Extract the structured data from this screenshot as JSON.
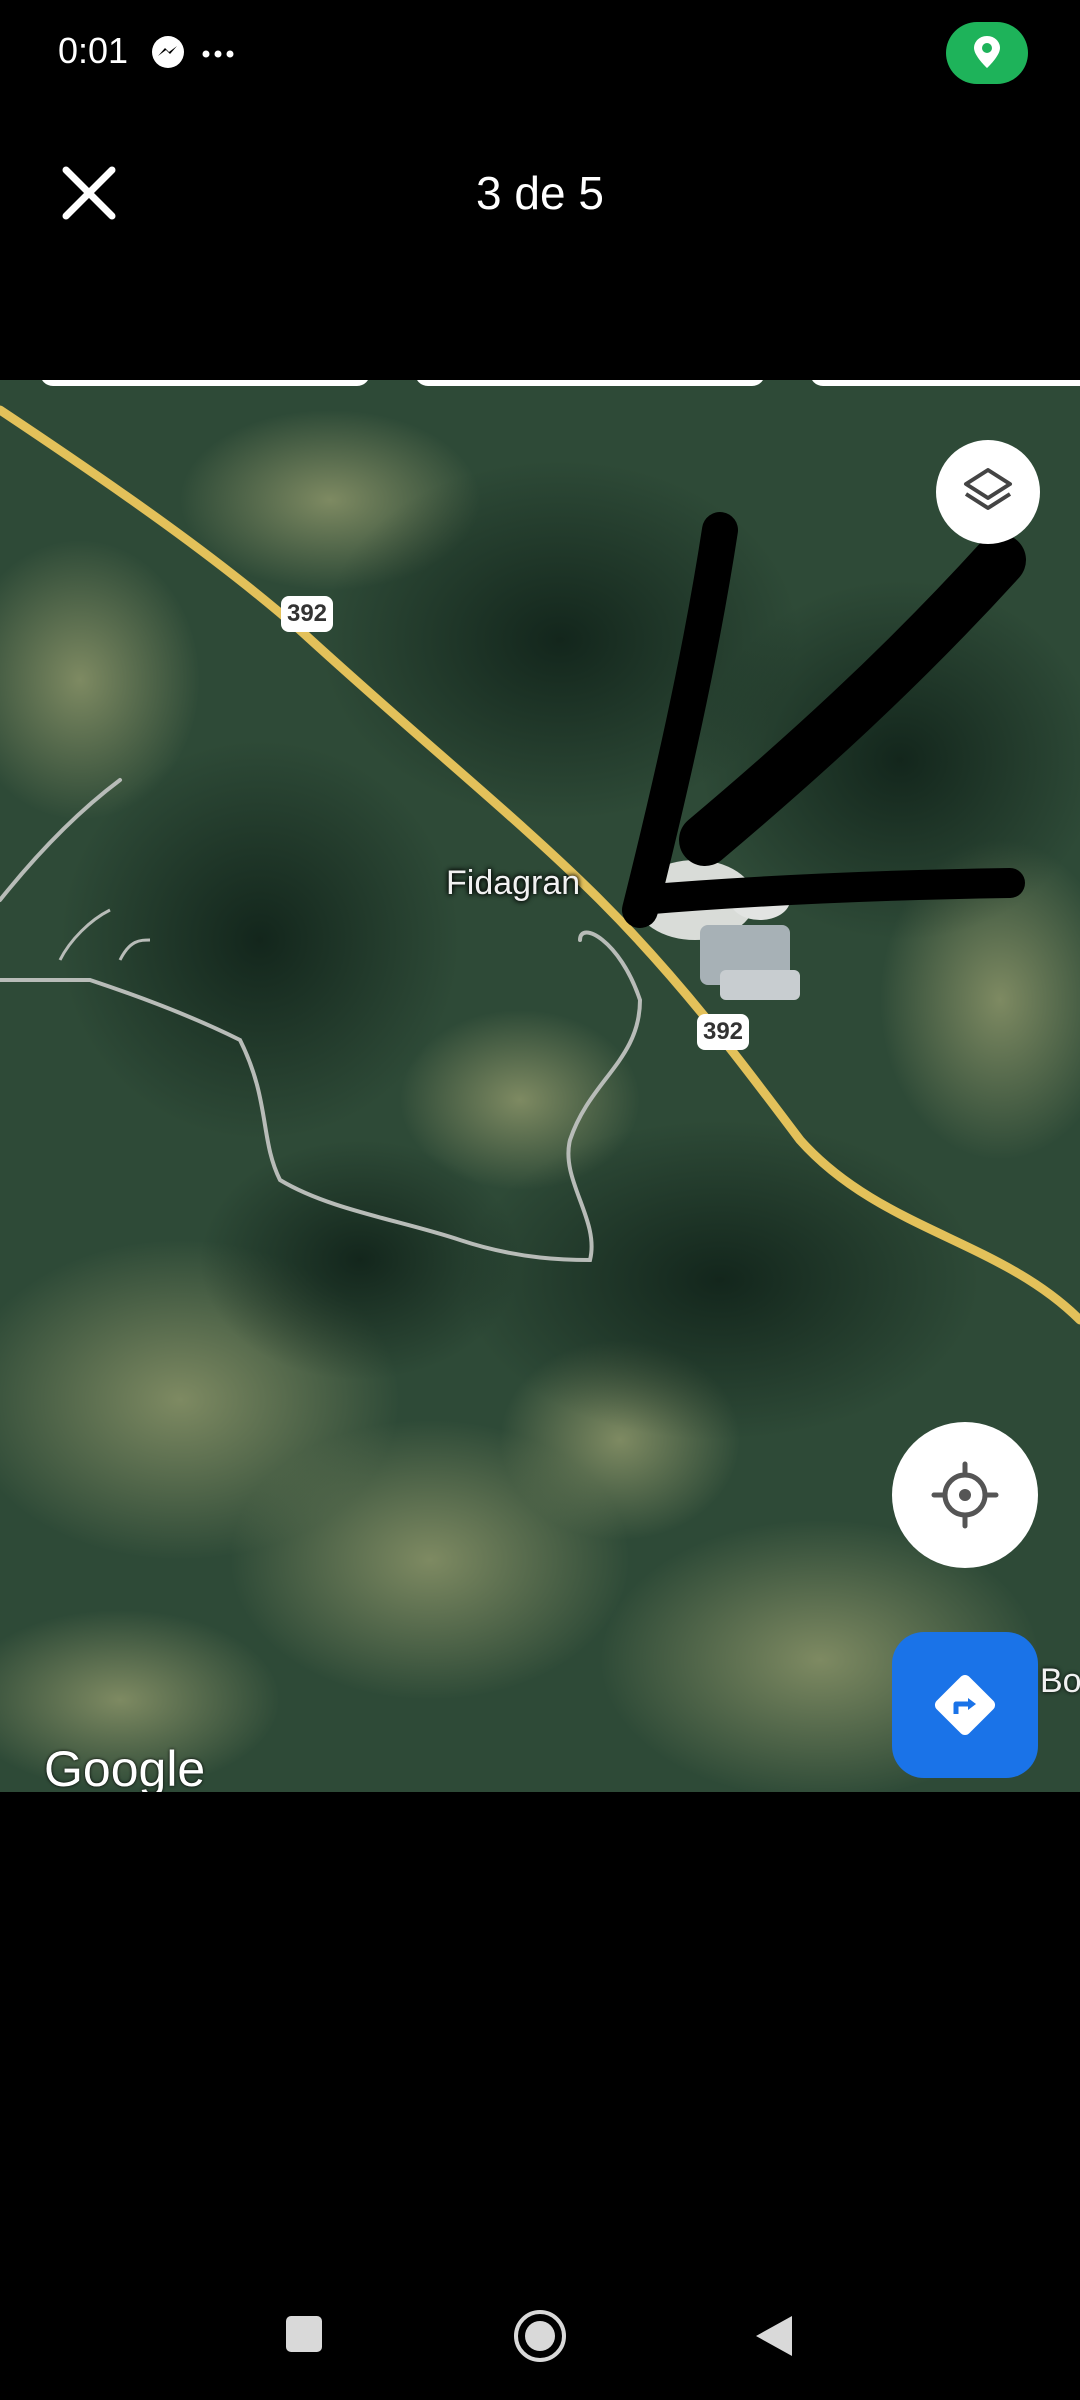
{
  "status_bar": {
    "time": "0:01",
    "icons": [
      "messenger-icon",
      "more-icon",
      "location-icon"
    ],
    "location_pill_color": "#1eb35a"
  },
  "viewer": {
    "counter": "3 de 5",
    "close_icon": "close-icon"
  },
  "map": {
    "place_label": "Fidagran",
    "route_number_upper": "392",
    "route_number_lower": "392",
    "edge_label": "Bo",
    "google_logo": "Google",
    "buttons": {
      "layers": "layers-icon",
      "my_location": "my-location-icon",
      "directions": "directions-icon"
    },
    "directions_color": "#1a73e8",
    "road_color": "#e3c15a"
  },
  "nav_bar": {
    "buttons": [
      "recents-icon",
      "home-icon",
      "back-icon"
    ]
  }
}
